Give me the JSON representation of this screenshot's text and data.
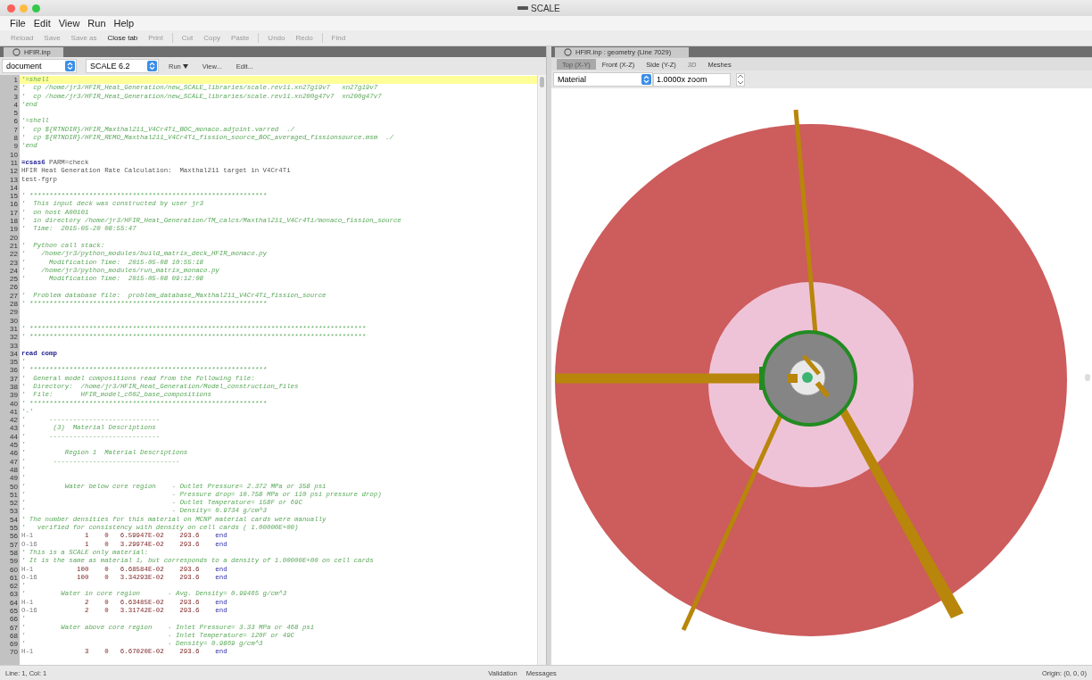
{
  "window": {
    "title": "SCALE"
  },
  "menu": [
    "File",
    "Edit",
    "View",
    "Run",
    "Help"
  ],
  "toolbar": [
    [
      {
        "label": "Reload",
        "disabled": true
      },
      {
        "label": "Save",
        "disabled": true
      },
      {
        "label": "Save as",
        "disabled": true
      },
      {
        "label": "Close tab",
        "disabled": false
      },
      {
        "label": "Print",
        "disabled": true
      }
    ],
    [
      {
        "label": "Cut",
        "disabled": true
      },
      {
        "label": "Copy",
        "disabled": true
      },
      {
        "label": "Paste",
        "disabled": true
      }
    ],
    [
      {
        "label": "Undo",
        "disabled": true
      },
      {
        "label": "Redo",
        "disabled": true
      }
    ],
    [
      {
        "label": "Find",
        "disabled": true
      }
    ]
  ],
  "editor": {
    "tab": {
      "label": "HFIR.inp",
      "selected": true
    },
    "mode_select": "document",
    "version_select": "SCALE 6.2",
    "buttons": [
      {
        "label": "Run",
        "kind": "menu"
      },
      {
        "label": "View...",
        "kind": "plain"
      },
      {
        "label": "Edit...",
        "kind": "plain"
      }
    ],
    "lines": [
      {
        "num": "1",
        "kind": "comment",
        "text": "'=shell",
        "current": true
      },
      {
        "num": "2",
        "kind": "comment",
        "text": "'  cp /home/jr3/HFIR_Heat_Generation/new_SCALE_libraries/scale.rev11.xn27g19v7   xn27g19v7",
        "current": false
      },
      {
        "num": "3",
        "kind": "comment",
        "text": "'  cp /home/jr3/HFIR_Heat_Generation/new_SCALE_libraries/scale.rev11.xn200g47v7  xn200g47v7",
        "current": false
      },
      {
        "num": "4",
        "kind": "comment",
        "text": "'end",
        "current": false
      },
      {
        "num": "5",
        "kind": "blank",
        "current": false
      },
      {
        "num": "6",
        "kind": "comment",
        "text": "'=shell",
        "current": false
      },
      {
        "num": "7",
        "kind": "comment",
        "text": "'  cp ${RTNDIR}/HFIR_Maxthal211_V4Cr4Ti_BOC_monaco.adjoint.varred  ./",
        "current": false
      },
      {
        "num": "8",
        "kind": "comment",
        "text": "'  cp ${RTNDIR}/HFIR_REMO_Maxthal211_V4Cr4Ti_fission_source_BOC_averaged_fissionsource.msm  ./",
        "current": false
      },
      {
        "num": "9",
        "kind": "comment",
        "text": "'end",
        "current": false
      },
      {
        "num": "10",
        "kind": "blank",
        "current": false
      },
      {
        "num": "11",
        "kind": "keyword",
        "keyword": "=csas6",
        "text": "PARM=check",
        "current": false
      },
      {
        "num": "12",
        "kind": "plain",
        "text": "HFIR Heat Generation Rate Calculation:  Maxthal211 target in V4Cr4Ti",
        "current": false
      },
      {
        "num": "13",
        "kind": "plain",
        "text": "test-fgrp",
        "current": false
      },
      {
        "num": "14",
        "kind": "blank",
        "current": false
      },
      {
        "num": "15",
        "kind": "comment",
        "text": "' ************************************************************",
        "current": false
      },
      {
        "num": "16",
        "kind": "comment",
        "text": "'  This input deck was constructed by user jr3",
        "current": false
      },
      {
        "num": "17",
        "kind": "comment",
        "text": "'  on host A00101",
        "current": false
      },
      {
        "num": "18",
        "kind": "comment",
        "text": "'  in directory /home/jr3/HFIR_Heat_Generation/TM_calcs/Maxthal211_V4Cr4Ti/monaco_fission_source",
        "current": false
      },
      {
        "num": "19",
        "kind": "comment",
        "text": "'  Time:  2015-05-20 08:55:47",
        "current": false
      },
      {
        "num": "20",
        "kind": "blank",
        "current": false
      },
      {
        "num": "21",
        "kind": "comment",
        "text": "'  Python call stack:",
        "current": false
      },
      {
        "num": "22",
        "kind": "comment",
        "text": "'    /home/jr3/python_modules/build_matrix_deck_HFIR_monaco.py",
        "current": false
      },
      {
        "num": "23",
        "kind": "comment",
        "text": "'      Modification Time:  2015-05-08 10:55:18",
        "current": false
      },
      {
        "num": "24",
        "kind": "comment",
        "text": "'    /home/jr3/python_modules/run_matrix_monaco.py",
        "current": false
      },
      {
        "num": "25",
        "kind": "comment",
        "text": "'      Modification Time:  2015-05-08 09:12:08",
        "current": false
      },
      {
        "num": "26",
        "kind": "blank",
        "current": false
      },
      {
        "num": "27",
        "kind": "comment",
        "text": "'  Problem database file:  problem_database_Maxthal211_V4Cr4Ti_fission_source",
        "current": false
      },
      {
        "num": "28",
        "kind": "comment",
        "text": "' ************************************************************",
        "current": false
      },
      {
        "num": "29",
        "kind": "blank",
        "current": false
      },
      {
        "num": "30",
        "kind": "blank",
        "current": false
      },
      {
        "num": "31",
        "kind": "comment",
        "text": "' *************************************************************************************",
        "current": false
      },
      {
        "num": "32",
        "kind": "comment",
        "text": "' *************************************************************************************",
        "current": false
      },
      {
        "num": "33",
        "kind": "blank",
        "current": false
      },
      {
        "num": "34",
        "kind": "keyword",
        "keyword": "read comp",
        "current": false
      },
      {
        "num": "35",
        "kind": "comment",
        "text": "'",
        "current": false
      },
      {
        "num": "36",
        "kind": "comment",
        "text": "' ************************************************************",
        "current": false
      },
      {
        "num": "37",
        "kind": "comment",
        "text": "'  General model compositions read from the following file:",
        "current": false
      },
      {
        "num": "38",
        "kind": "comment",
        "text": "'  Directory:  /home/jr3/HFIR_Heat_Generation/Model_construction_files",
        "current": false
      },
      {
        "num": "39",
        "kind": "comment",
        "text": "'  File:       HFIR_model_c602_base_compositions",
        "current": false
      },
      {
        "num": "40",
        "kind": "comment",
        "text": "' ************************************************************",
        "current": false
      },
      {
        "num": "41",
        "kind": "comment",
        "text": "'-'",
        "current": false
      },
      {
        "num": "42",
        "kind": "comment",
        "text": "'      ----------------------------",
        "current": false
      },
      {
        "num": "43",
        "kind": "comment",
        "text": "'       (3)  Material Descriptions",
        "current": false
      },
      {
        "num": "44",
        "kind": "comment",
        "text": "'      ----------------------------",
        "current": false
      },
      {
        "num": "45",
        "kind": "comment",
        "text": "'",
        "current": false
      },
      {
        "num": "46",
        "kind": "comment",
        "text": "'          Region 1  Material Descriptions",
        "current": false
      },
      {
        "num": "47",
        "kind": "comment",
        "text": "'       --------------------------------",
        "current": false
      },
      {
        "num": "48",
        "kind": "comment",
        "text": "'",
        "current": false
      },
      {
        "num": "49",
        "kind": "comment",
        "text": "'",
        "current": false
      },
      {
        "num": "50",
        "kind": "comment",
        "text": "'          Water below core region    - Outlet Pressure= 2.372 MPa or 358 psi",
        "current": false
      },
      {
        "num": "51",
        "kind": "comment",
        "text": "'                                     - Pressure drop= 10.758 MPa or 110 psi pressure drop)",
        "current": false
      },
      {
        "num": "52",
        "kind": "comment",
        "text": "'                                     - Outlet Temperature= 158F or 69C",
        "current": false
      },
      {
        "num": "53",
        "kind": "comment",
        "text": "'                                     - Density= 0.9734 g/cm^3",
        "current": false
      },
      {
        "num": "54",
        "kind": "comment",
        "text": "' The number densities for this material on MCNP material cards were manually",
        "current": false
      },
      {
        "num": "55",
        "kind": "comment",
        "text": "'   verified for consistency with density on cell cards ( 1.00000E+00)",
        "current": false
      },
      {
        "num": "56",
        "kind": "data",
        "fields": [
          "H-1",
          "1",
          "0",
          "6.59947E-02",
          "293.6",
          "end"
        ],
        "current": false
      },
      {
        "num": "57",
        "kind": "data",
        "fields": [
          "O-16",
          "1",
          "0",
          "3.29974E-02",
          "293.6",
          "end"
        ],
        "current": false
      },
      {
        "num": "58",
        "kind": "comment",
        "text": "' This is a SCALE only material:",
        "current": false
      },
      {
        "num": "59",
        "kind": "comment",
        "text": "' It is the same as material 1, but corresponds to a density of 1.00000E+00 on cell cards",
        "current": false
      },
      {
        "num": "60",
        "kind": "data",
        "fields": [
          "H-1",
          "100",
          "0",
          "6.68584E-02",
          "293.6",
          "end"
        ],
        "current": false
      },
      {
        "num": "61",
        "kind": "data",
        "fields": [
          "O-16",
          "100",
          "0",
          "3.34293E-02",
          "293.6",
          "end"
        ],
        "current": false
      },
      {
        "num": "62",
        "kind": "comment",
        "text": "'",
        "current": false
      },
      {
        "num": "63",
        "kind": "comment",
        "text": "'         Water in core region       - Avg. Density= 0.99465 g/cm^3",
        "current": false
      },
      {
        "num": "64",
        "kind": "data",
        "fields": [
          "H-1",
          "2",
          "0",
          "6.63485E-02",
          "293.6",
          "end"
        ],
        "current": false
      },
      {
        "num": "65",
        "kind": "data",
        "fields": [
          "O-16",
          "2",
          "0",
          "3.31742E-02",
          "293.6",
          "end"
        ],
        "current": false
      },
      {
        "num": "66",
        "kind": "comment",
        "text": "'",
        "current": false
      },
      {
        "num": "67",
        "kind": "comment",
        "text": "'         Water above core region    - Inlet Pressure= 3.33 MPa or 468 psi",
        "current": false
      },
      {
        "num": "68",
        "kind": "comment",
        "text": "'                                    - Inlet Temperature= 120F or 49C",
        "current": false
      },
      {
        "num": "69",
        "kind": "comment",
        "text": "'                                    - Density= 0.9869 g/cm^3",
        "current": false
      },
      {
        "num": "70",
        "kind": "data",
        "fields": [
          "H-1",
          "3",
          "0",
          "6.67020E-02",
          "293.6",
          "end"
        ],
        "current": false
      }
    ]
  },
  "geometry": {
    "tab": {
      "label": "HFIR.inp : geometry (Line 7029)",
      "selected": true
    },
    "views": [
      {
        "label": "Top (X-Y)",
        "selected": true,
        "disabled": false
      },
      {
        "label": "Front (X-Z)",
        "selected": false,
        "disabled": false
      },
      {
        "label": "Side (Y-Z)",
        "selected": false,
        "disabled": false
      },
      {
        "label": "3D",
        "selected": false,
        "disabled": true
      },
      {
        "label": "Meshes",
        "selected": false,
        "disabled": false
      }
    ],
    "color_by": "Material",
    "zoom": "1.0000x zoom"
  },
  "status_bar": {
    "position": "Line: 1, Col: 1",
    "tabs": [
      "Validation",
      "Messages"
    ],
    "origin": "Origin: (0, 0, 0)"
  }
}
